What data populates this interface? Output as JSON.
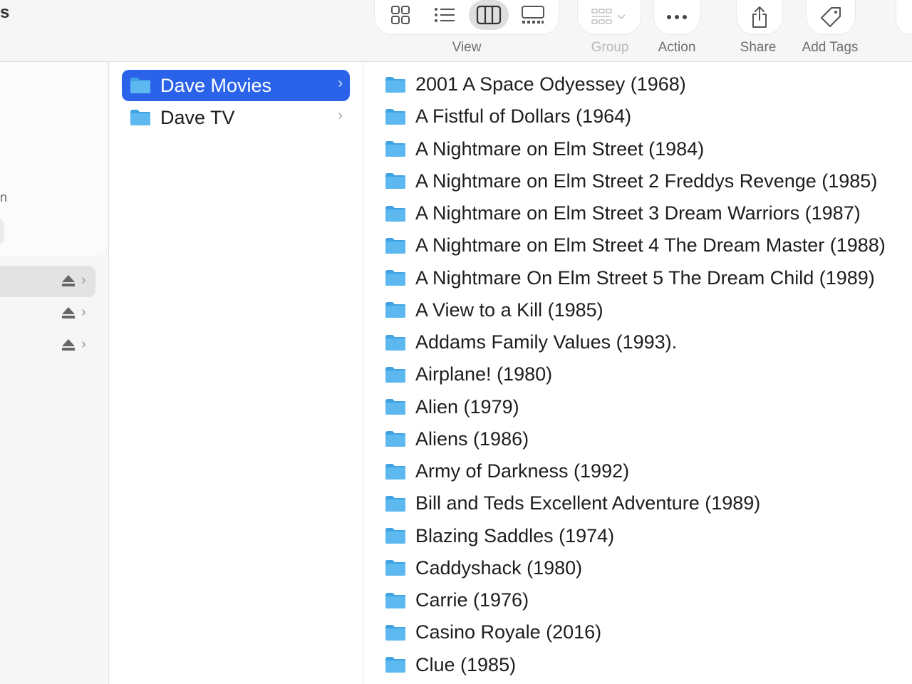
{
  "window": {
    "title_fragment": "s"
  },
  "toolbar": {
    "view_buttons": [
      {
        "name": "icon-view-button",
        "icon": "grid-icon",
        "active": false
      },
      {
        "name": "list-view-button",
        "icon": "list-icon",
        "active": false
      },
      {
        "name": "column-view-button",
        "icon": "columns-icon",
        "active": true
      },
      {
        "name": "gallery-view-button",
        "icon": "gallery-icon",
        "active": false
      }
    ],
    "view_label": "View",
    "group_label": "Group",
    "action_label": "Action",
    "share_label": "Share",
    "add_tags_label": "Add Tags",
    "group_icon": "group-grid-icon",
    "action_icon": "ellipsis-icon",
    "share_icon": "share-icon",
    "tags_icon": "tag-icon"
  },
  "sidebar": {
    "label_fragment": "n",
    "locations": [
      {
        "selected": true,
        "icon": "eject-icon"
      },
      {
        "selected": false,
        "icon": "eject-icon"
      },
      {
        "selected": false,
        "icon": "eject-icon"
      }
    ]
  },
  "column1": {
    "items": [
      {
        "label": "Dave Movies",
        "selected": true
      },
      {
        "label": "Dave TV",
        "selected": false
      }
    ]
  },
  "column2": {
    "items": [
      {
        "label": "2001 A Space Odyessey (1968)"
      },
      {
        "label": "A Fistful of Dollars (1964)"
      },
      {
        "label": "A Nightmare on Elm Street (1984)"
      },
      {
        "label": "A Nightmare on Elm Street 2 Freddys Revenge (1985)"
      },
      {
        "label": "A Nightmare on Elm Street 3 Dream Warriors (1987)"
      },
      {
        "label": "A Nightmare on Elm Street 4 The Dream Master (1988)"
      },
      {
        "label": "A Nightmare On Elm Street 5 The Dream Child (1989)"
      },
      {
        "label": "A View to a Kill (1985)"
      },
      {
        "label": "Addams Family Values (1993)."
      },
      {
        "label": "Airplane! (1980)"
      },
      {
        "label": "Alien (1979)"
      },
      {
        "label": "Aliens (1986)"
      },
      {
        "label": "Army of Darkness (1992)"
      },
      {
        "label": "Bill and Teds Excellent Adventure (1989)"
      },
      {
        "label": "Blazing Saddles (1974)"
      },
      {
        "label": "Caddyshack (1980)"
      },
      {
        "label": "Carrie (1976)"
      },
      {
        "label": "Casino Royale (2016)"
      },
      {
        "label": "Clue (1985)"
      }
    ]
  },
  "colors": {
    "selection_blue": "#2a63e9",
    "folder_blue": "#5cb8ef",
    "folder_tab": "#3fa3e3",
    "toolbar_bg": "#f6f6f6"
  }
}
